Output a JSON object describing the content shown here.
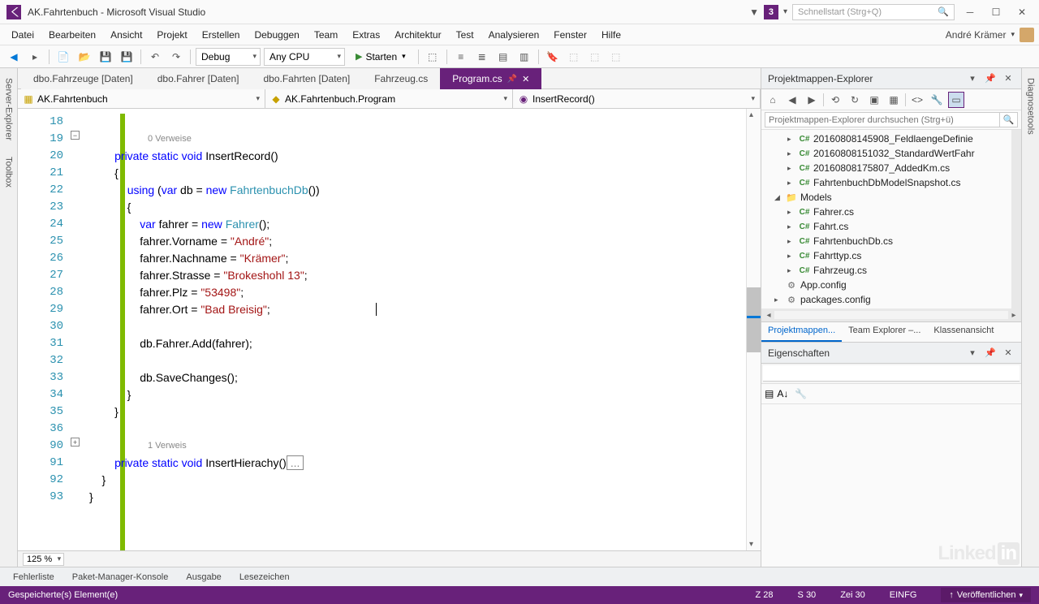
{
  "app": {
    "title": "AK.Fahrtenbuch - Microsoft Visual Studio",
    "user": "André Krämer",
    "ml_badge": "3",
    "quickstart_placeholder": "Schnellstart (Strg+Q)"
  },
  "menu": [
    "Datei",
    "Bearbeiten",
    "Ansicht",
    "Projekt",
    "Erstellen",
    "Debuggen",
    "Team",
    "Extras",
    "Architektur",
    "Test",
    "Analysieren",
    "Fenster",
    "Hilfe"
  ],
  "toolbar": {
    "config": "Debug",
    "platform": "Any CPU",
    "start": "Starten"
  },
  "left_rail": [
    "Server-Explorer",
    "Toolbox"
  ],
  "tabs": [
    {
      "label": "dbo.Fahrzeuge [Daten]",
      "active": false
    },
    {
      "label": "dbo.Fahrer [Daten]",
      "active": false
    },
    {
      "label": "dbo.Fahrten [Daten]",
      "active": false
    },
    {
      "label": "Fahrzeug.cs",
      "active": false
    },
    {
      "label": "Program.cs",
      "active": true
    }
  ],
  "nav": {
    "project": "AK.Fahrtenbuch",
    "class": "AK.Fahrtenbuch.Program",
    "method": "InsertRecord()"
  },
  "code": {
    "first_line": 18,
    "refs0": "0 Verweise",
    "refs1": "1 Verweis",
    "l19": "private static void InsertRecord()",
    "l20": "{",
    "l21": "    using (var db = new FahrtenbuchDb())",
    "l22": "    {",
    "l23": "        var fahrer = new Fahrer();",
    "l24": "        fahrer.Vorname = \"André\";",
    "l25": "        fahrer.Nachname = \"Krämer\";",
    "l26": "        fahrer.Strasse = \"Brokeshohl 13\";",
    "l27": "        fahrer.Plz = \"53498\";",
    "l28": "        fahrer.Ort = \"Bad Breisig\";",
    "l30": "        db.Fahrer.Add(fahrer);",
    "l32": "        db.SaveChanges();",
    "l33": "    }",
    "l34": "}",
    "l36": "private static void InsertHierachy()",
    "l36_fold": "...",
    "l90": "    }",
    "l91": "}",
    "zoom": "125 %"
  },
  "explorer": {
    "title": "Projektmappen-Explorer",
    "search_placeholder": "Projektmappen-Explorer durchsuchen (Strg+ü)",
    "items": [
      {
        "label": "20160808145908_FeldlaengeDefinie",
        "icon": "cs",
        "indent": 2,
        "exp": "▸"
      },
      {
        "label": "20160808151032_StandardWertFahr",
        "icon": "cs",
        "indent": 2,
        "exp": "▸"
      },
      {
        "label": "20160808175807_AddedKm.cs",
        "icon": "cs",
        "indent": 2,
        "exp": "▸"
      },
      {
        "label": "FahrtenbuchDbModelSnapshot.cs",
        "icon": "cs",
        "indent": 2,
        "exp": "▸"
      },
      {
        "label": "Models",
        "icon": "folder",
        "indent": 1,
        "exp": "◢"
      },
      {
        "label": "Fahrer.cs",
        "icon": "cs",
        "indent": 2,
        "exp": "▸"
      },
      {
        "label": "Fahrt.cs",
        "icon": "cs",
        "indent": 2,
        "exp": "▸"
      },
      {
        "label": "FahrtenbuchDb.cs",
        "icon": "cs",
        "indent": 2,
        "exp": "▸"
      },
      {
        "label": "Fahrttyp.cs",
        "icon": "cs",
        "indent": 2,
        "exp": "▸"
      },
      {
        "label": "Fahrzeug.cs",
        "icon": "cs",
        "indent": 2,
        "exp": "▸"
      },
      {
        "label": "App.config",
        "icon": "cfg",
        "indent": 1,
        "exp": ""
      },
      {
        "label": "packages.config",
        "icon": "cfg",
        "indent": 1,
        "exp": "▸"
      }
    ],
    "panel_tabs": [
      "Projektmappen...",
      "Team Explorer –...",
      "Klassenansicht"
    ]
  },
  "properties": {
    "title": "Eigenschaften"
  },
  "right_rail": [
    "Diagnosetools"
  ],
  "bottom_tabs": [
    "Fehlerliste",
    "Paket-Manager-Konsole",
    "Ausgabe",
    "Lesezeichen"
  ],
  "status": {
    "left": "Gespeicherte(s) Element(e)",
    "line": "Z 28",
    "col": "S 30",
    "ch": "Zei 30",
    "ins": "EINFG",
    "publish": "Veröffentlichen"
  }
}
